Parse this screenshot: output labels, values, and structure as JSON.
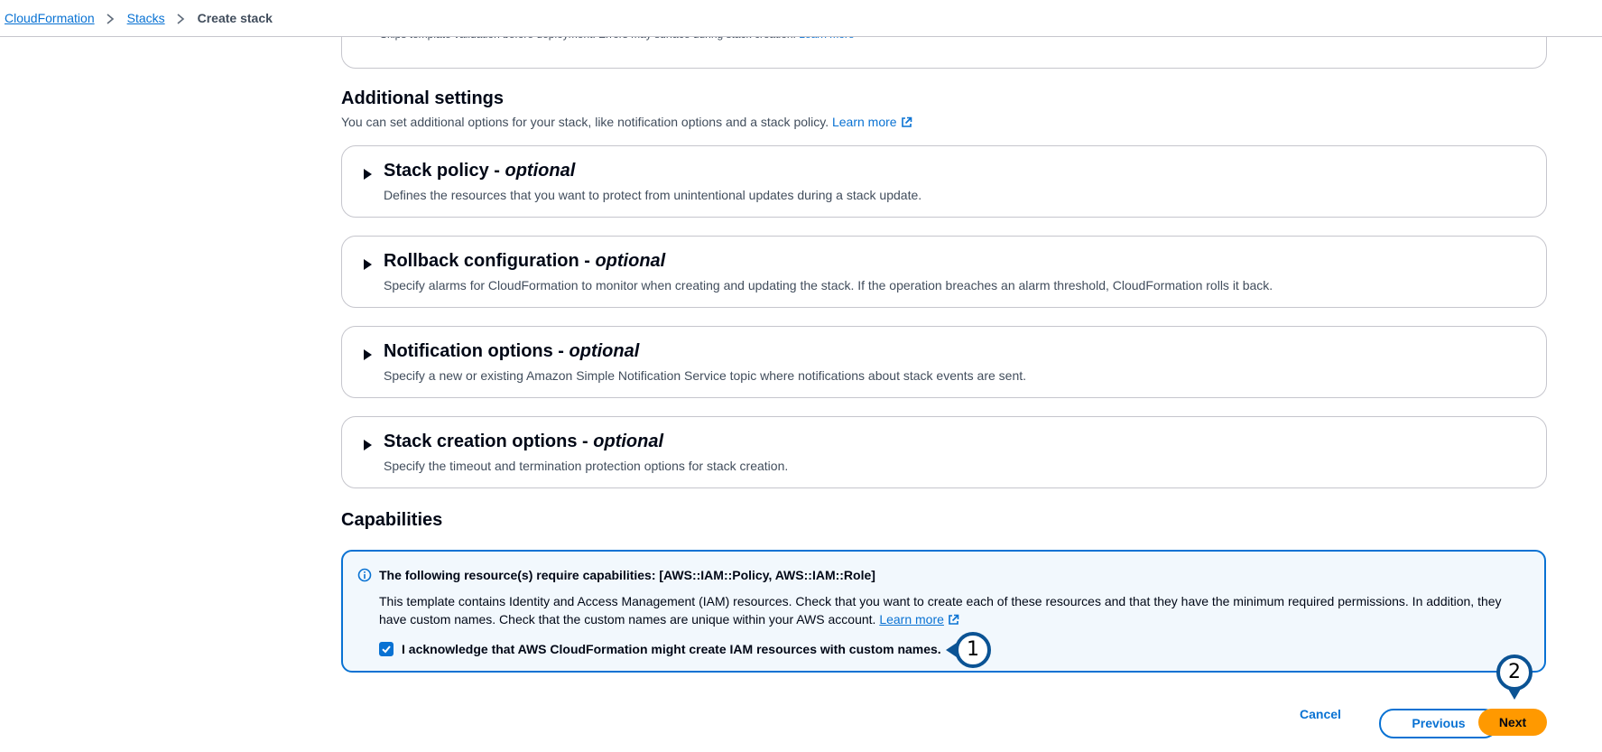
{
  "breadcrumb": {
    "items": [
      "CloudFormation",
      "Stacks"
    ],
    "current": "Create stack"
  },
  "previous_section": {
    "description": "Skips template validation before deployment. Errors may surface during stack creation.",
    "learn_more": "Learn more"
  },
  "additional_settings": {
    "title": "Additional settings",
    "subtitle": "You can set additional options for your stack, like notification options and a stack policy.",
    "learn_more": "Learn more",
    "sections": [
      {
        "title": "Stack policy - ",
        "optional": "optional",
        "description": "Defines the resources that you want to protect from unintentional updates during a stack update."
      },
      {
        "title": "Rollback configuration - ",
        "optional": "optional",
        "description": "Specify alarms for CloudFormation to monitor when creating and updating the stack. If the operation breaches an alarm threshold, CloudFormation rolls it back."
      },
      {
        "title": "Notification options - ",
        "optional": "optional",
        "description": "Specify a new or existing Amazon Simple Notification Service topic where notifications about stack events are sent."
      },
      {
        "title": "Stack creation options - ",
        "optional": "optional",
        "description": "Specify the timeout and termination protection options for stack creation."
      }
    ]
  },
  "capabilities": {
    "title": "Capabilities",
    "alert_title": "The following resource(s) require capabilities: [AWS::IAM::Policy, AWS::IAM::Role]",
    "alert_body": "This template contains Identity and Access Management (IAM) resources. Check that you want to create each of these resources and that they have the minimum required permissions. In addition, they have custom names. Check that the custom names are unique within your AWS account.",
    "learn_more": "Learn more",
    "acknowledge_label": "I acknowledge that AWS CloudFormation might create IAM resources with custom names.",
    "acknowledged": true
  },
  "actions": {
    "cancel": "Cancel",
    "previous": "Previous",
    "next": "Next"
  },
  "markers": [
    "1",
    "2"
  ],
  "colors": {
    "link": "#0972d3",
    "primary_button": "#ff9900",
    "alert_bg": "#f2f8fd",
    "marker_ring": "#0b5394"
  }
}
